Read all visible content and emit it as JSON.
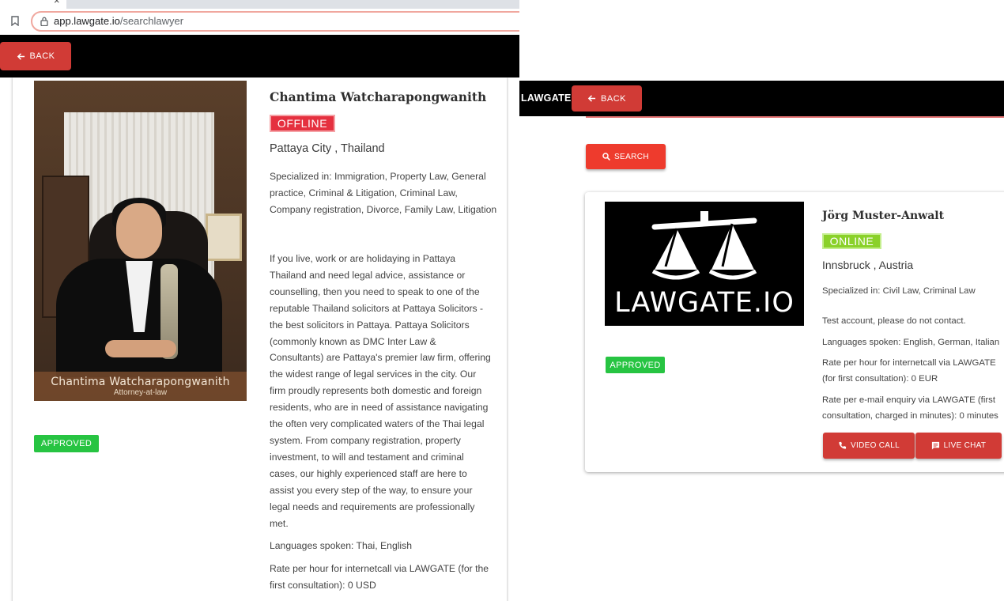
{
  "browser": {
    "url_host": "app.lawgate.io",
    "url_path": "/searchlawyer"
  },
  "left_view": {
    "back_label": "BACK",
    "lawyer": {
      "photo_caption_name": "Chantima Watcharapongwanith",
      "photo_caption_title": "Attorney-at-law",
      "name": "Chantima Watcharapongwanith",
      "status": "OFFLINE",
      "location": "Pattaya City , Thailand",
      "approval": "APPROVED",
      "specialized": "Specialized in: Immigration, Property Law, General practice, Criminal & Litigation, Criminal Law, Company registration, Divorce, Family Law, Litigation",
      "about": "If you live, work or are holidaying in Pattaya Thailand and need legal advice, assistance or counselling, then you need to speak to one of the reputable Thailand solicitors at Pattaya Solicitors - the best solicitors in Pattaya. Pattaya Solicitors (commonly known as DMC Inter Law & Consultants) are Pattaya's premier law firm, offering the widest range of legal services in the city. Our firm proudly represents both domestic and foreign residents, who are in need of assistance navigating the often very complicated waters of the Thai legal system. From company registration, property investment, to will and testament and criminal cases, our highly experienced staff are here to assist you every step of the way, to ensure your legal needs and requirements are professionally met.",
      "languages": "Languages spoken: Thai, English",
      "rate_call": "Rate per hour for internetcall via LAWGATE (for the first consultation): 0 USD"
    }
  },
  "right_view": {
    "brand": "LAWGATE",
    "back_label": "BACK",
    "search_label": "SEARCH",
    "lawyer": {
      "logo_text": "LAWGATE.IO",
      "name": "Jörg Muster-Anwalt",
      "status": "ONLINE",
      "location": "Innsbruck , Austria",
      "approval": "APPROVED",
      "specialized": "Specialized in: Civil Law, Criminal Law",
      "note": "Test account, please do not contact.",
      "languages": "Languages spoken: English, German, Italian",
      "rate_call": "Rate per hour for internetcall via LAWGATE (for first consultation): 0 EUR",
      "rate_email": "Rate per e-mail enquiry via LAWGATE (first consultation, charged in minutes): 0 minutes",
      "video_call_label": "VIDEO CALL",
      "live_chat_label": "LIVE CHAT"
    }
  },
  "colors": {
    "offline": "#e5303f",
    "online": "#8ad12a",
    "approved": "#27c442",
    "back_button": "#d13b36",
    "search_button": "#ee3b2d",
    "appbar": "#000000"
  },
  "icons": [
    "bookmark-icon",
    "lock-icon",
    "arrow-left-icon",
    "search-icon",
    "phone-icon",
    "chat-icon",
    "scales-icon"
  ]
}
